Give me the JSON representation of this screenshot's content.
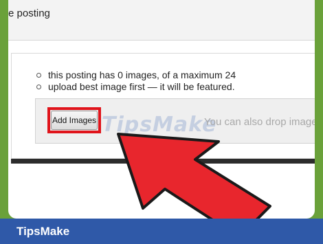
{
  "page": {
    "heading": "e posting"
  },
  "upload_panel": {
    "bullets": [
      "this posting has 0 images, of a maximum 24",
      "upload best image first — it will be featured."
    ],
    "add_images_label": "Add Images",
    "drop_hint": "You can also drop image",
    "watermark": "TipsMake"
  },
  "footer": {
    "brand": "TipsMake"
  },
  "colors": {
    "background_green": "#6aa13a",
    "highlight_red": "#e0141b",
    "footer_blue": "#2f59a8"
  },
  "icons": {
    "pointer": "red-arrow-icon"
  }
}
